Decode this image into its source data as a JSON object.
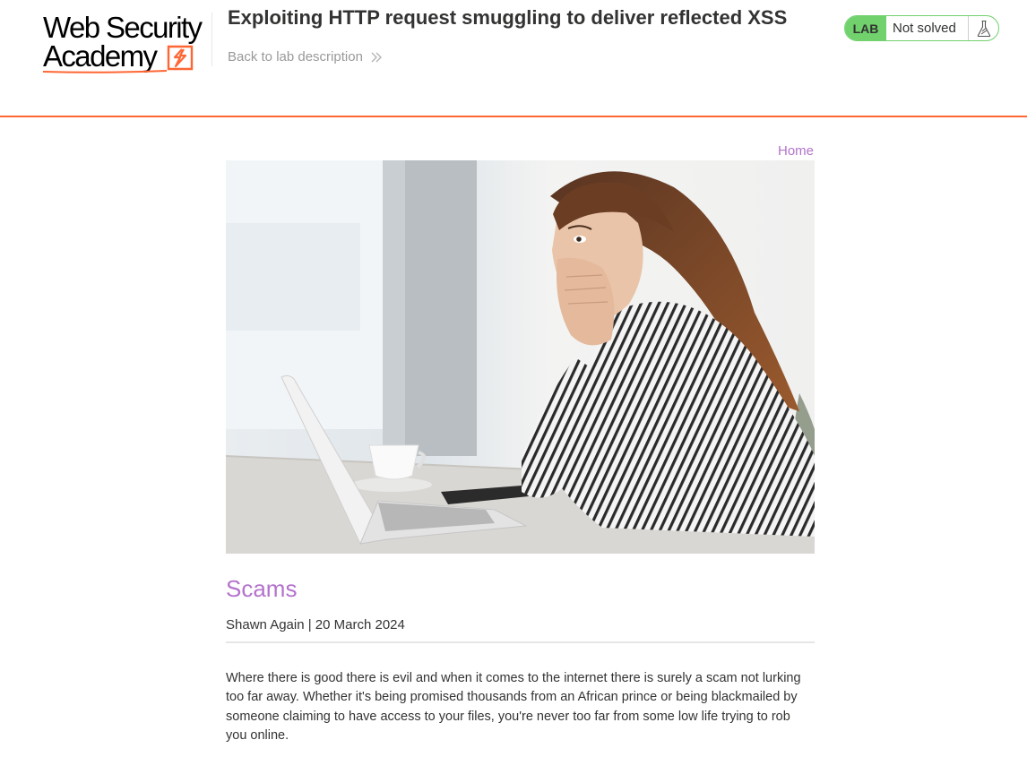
{
  "header": {
    "logo_line1": "Web Security",
    "logo_line2": "Academy",
    "lab_title": "Exploiting HTTP request smuggling to deliver reflected XSS",
    "back_link": "Back to lab description",
    "lab_badge": "LAB",
    "lab_status": "Not solved",
    "icons": {
      "back": "double-chevron-right-icon",
      "flask": "flask-icon",
      "logo_mark": "academy-lightning-icon"
    }
  },
  "nav": {
    "home": "Home"
  },
  "post": {
    "image_alt": "Woman covering her mouth in shock looking at a laptop",
    "title": "Scams",
    "meta": "Shawn Again | 20 March 2024",
    "body": "Where there is good there is evil and when it comes to the internet there is surely a scam not lurking too far away. Whether it's being promised thousands from an African prince or being blackmailed by someone claiming to have access to your files, you're never too far from some low life trying to rob you online."
  },
  "colors": {
    "accent_orange": "#ff6633",
    "link_purple": "#b373cc",
    "lab_green": "#70d16d",
    "text": "#333332",
    "muted": "#999999"
  }
}
